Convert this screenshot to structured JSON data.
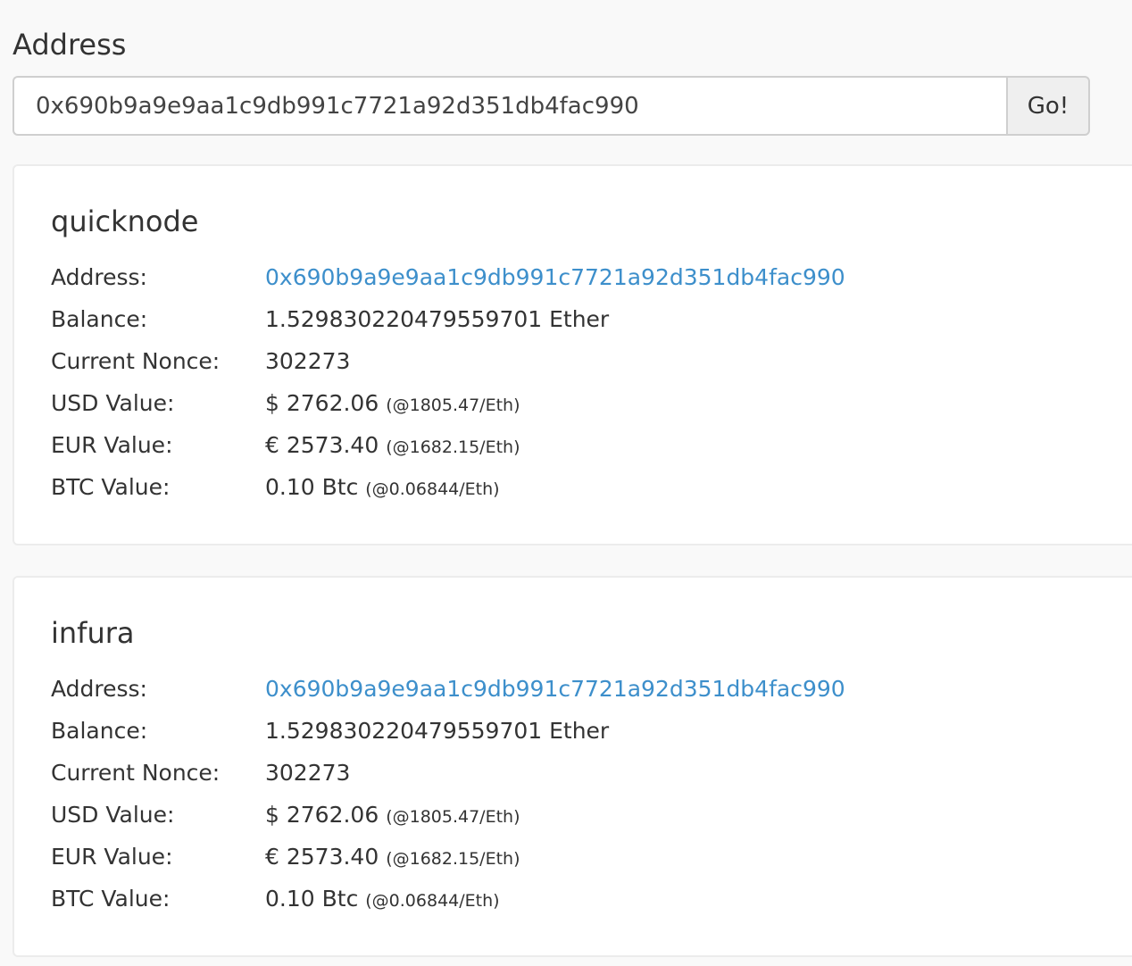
{
  "search": {
    "heading": "Address",
    "input_value": "0x690b9a9e9aa1c9db991c7721a92d351db4fac990",
    "go_label": "Go!"
  },
  "labels": {
    "address": "Address:",
    "balance": "Balance:",
    "nonce": "Current Nonce:",
    "usd": "USD Value:",
    "eur": "EUR Value:",
    "btc": "BTC Value:"
  },
  "providers": [
    {
      "name": "quicknode",
      "address": "0x690b9a9e9aa1c9db991c7721a92d351db4fac990",
      "balance": "1.529830220479559701 Ether",
      "nonce": "302273",
      "usd_value": "$ 2762.06",
      "usd_rate": "(@1805.47/Eth)",
      "eur_value": "€ 2573.40",
      "eur_rate": "(@1682.15/Eth)",
      "btc_value": "0.10 Btc",
      "btc_rate": "(@0.06844/Eth)"
    },
    {
      "name": "infura",
      "address": "0x690b9a9e9aa1c9db991c7721a92d351db4fac990",
      "balance": "1.529830220479559701 Ether",
      "nonce": "302273",
      "usd_value": "$ 2762.06",
      "usd_rate": "(@1805.47/Eth)",
      "eur_value": "€ 2573.40",
      "eur_rate": "(@1682.15/Eth)",
      "btc_value": "0.10 Btc",
      "btc_rate": "(@0.06844/Eth)"
    }
  ]
}
